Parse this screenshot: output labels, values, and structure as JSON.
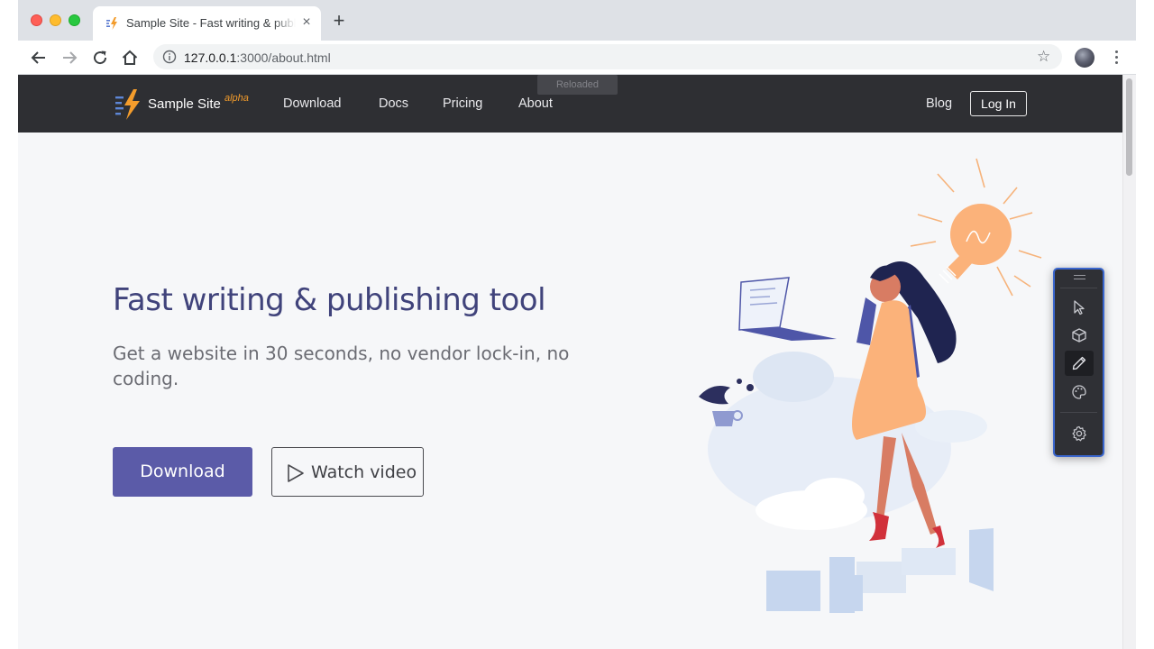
{
  "browser": {
    "tab_title": "Sample Site - Fast writing & publishing tool",
    "tab_close": "×",
    "new_tab": "+",
    "url_host": "127.0.0.1",
    "url_rest": ":3000/about.html",
    "bookmark_star": "☆"
  },
  "site": {
    "logo_text": "Sample Site",
    "logo_badge": "alpha",
    "nav": [
      "Download",
      "Docs",
      "Pricing",
      "About"
    ],
    "nav_right": {
      "blog": "Blog",
      "login": "Log In"
    },
    "reload_toast": "Reloaded"
  },
  "hero": {
    "title": "Fast writing & publishing tool",
    "subtitle": "Get a website in 30 seconds, no vendor lock-in, no coding.",
    "primary_button": "Download",
    "secondary_button": "Watch video"
  },
  "tool_panel": {
    "tools": [
      "cursor-icon",
      "cube-icon",
      "pencil-icon",
      "palette-icon",
      "gear-icon"
    ],
    "active_tool": "pencil-icon"
  },
  "colors": {
    "navbar": "#2e2f33",
    "accent": "#5b5ba8",
    "title": "#40437b",
    "brand_orange": "#f39c2c",
    "panel_border": "#3a66ce"
  }
}
